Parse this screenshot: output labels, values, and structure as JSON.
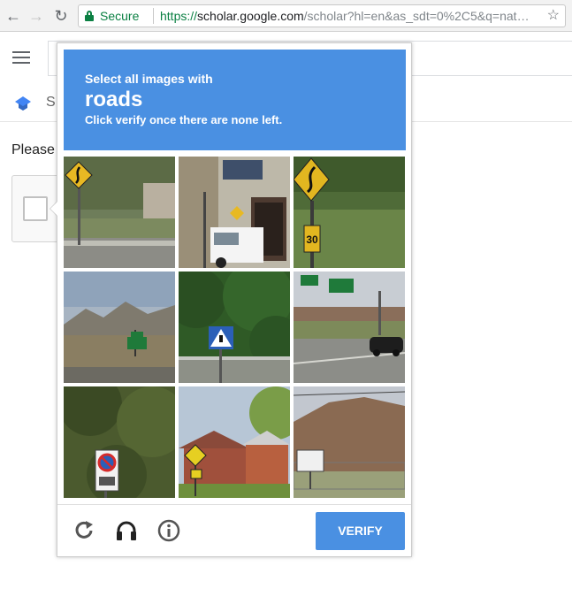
{
  "browser": {
    "secure_label": "Secure",
    "url_scheme": "https://",
    "url_host": "scholar.google.com",
    "url_path": "/scholar?hl=en&as_sdt=0%2C5&q=nat…"
  },
  "page": {
    "search_partial": "r",
    "brand_partial": "S",
    "message_partial": "Please"
  },
  "captcha": {
    "instruction_line1": "Select all images with",
    "target_word": "roads",
    "instruction_line3": "Click verify once there are none left.",
    "verify_label": "VERIFY",
    "header_color": "#4a90e2",
    "tiles": [
      {
        "scene": "yellow-curve-sign-roadside"
      },
      {
        "scene": "street-building-van"
      },
      {
        "scene": "yellow-curve-sign-speed-30"
      },
      {
        "scene": "mountain-highway-green-sign"
      },
      {
        "scene": "pedestrian-crossing-sign-trees"
      },
      {
        "scene": "highway-overhead-sign-car"
      },
      {
        "scene": "no-parking-sign-trees"
      },
      {
        "scene": "houses-pedestrian-sign"
      },
      {
        "scene": "rock-hill-fence-sign"
      }
    ]
  }
}
